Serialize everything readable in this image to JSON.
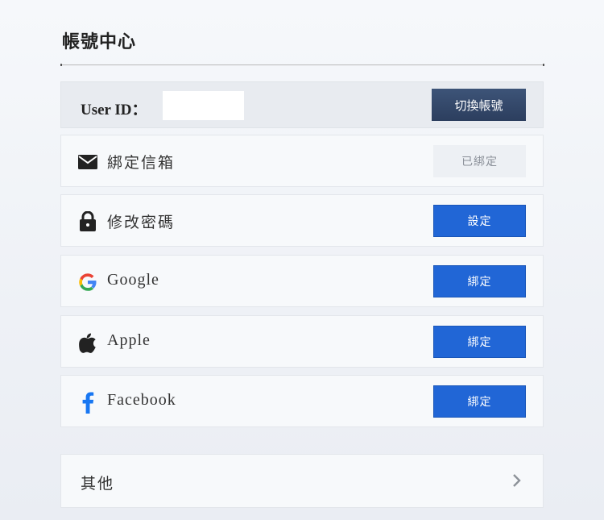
{
  "page": {
    "title": "帳號中心"
  },
  "user": {
    "label": "User ID：",
    "value": "",
    "switch_label": "切換帳號"
  },
  "items": [
    {
      "label": "綁定信箱",
      "action": "已綁定",
      "icon": "mail-icon"
    },
    {
      "label": "修改密碼",
      "action": "設定",
      "icon": "lock-icon"
    },
    {
      "label": "Google",
      "action": "綁定",
      "icon": "google-icon"
    },
    {
      "label": "Apple",
      "action": "綁定",
      "icon": "apple-icon"
    },
    {
      "label": "Facebook",
      "action": "綁定",
      "icon": "facebook-icon"
    }
  ],
  "other": {
    "label": "其他",
    "icon": "chevron-right-icon"
  },
  "colors": {
    "primary": "#2166d6",
    "switch": "#344b6e",
    "bound": "#edf0f4"
  }
}
